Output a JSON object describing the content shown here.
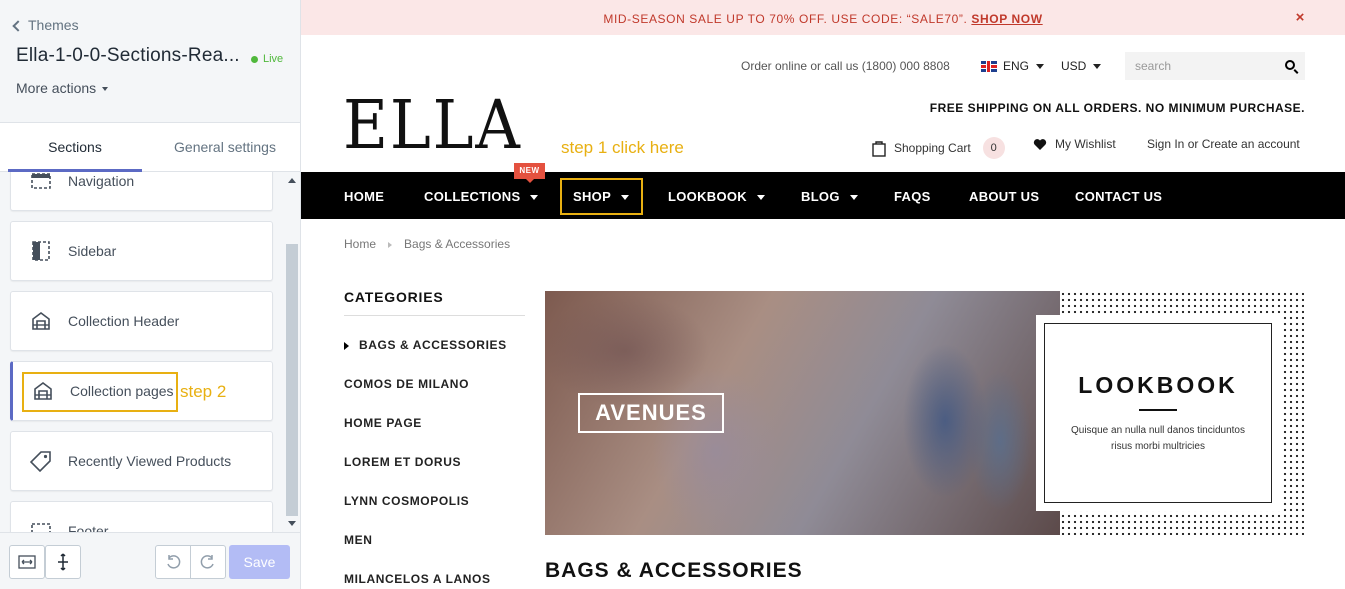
{
  "editor": {
    "back_label": "Themes",
    "theme_name": "Ella-1-0-0-Sections-Rea...",
    "status": "Live",
    "more_actions": "More actions",
    "tabs": [
      {
        "label": "Sections",
        "active": true
      },
      {
        "label": "General settings",
        "active": false
      }
    ],
    "sections": [
      {
        "label": "Navigation",
        "icon": "navigation-icon"
      },
      {
        "label": "Sidebar",
        "icon": "sidebar-icon"
      },
      {
        "label": "Collection Header",
        "icon": "collection-icon"
      },
      {
        "label": "Collection pages",
        "icon": "collection-icon"
      },
      {
        "label": "Recently Viewed Products",
        "icon": "tag-icon"
      },
      {
        "label": "Footer",
        "icon": "footer-icon"
      }
    ],
    "step2_note": "step 2",
    "save_label": "Save",
    "accent": "#5c6ac4",
    "highlight": "#e8b012"
  },
  "store": {
    "promo": {
      "text": "MID-SEASON SALE UP TO 70% OFF. USE CODE: “SALE70”.",
      "link": "SHOP NOW",
      "close": "×"
    },
    "contact": "Order online or call us (1800) 000 8808",
    "language": "ENG",
    "currency": "USD",
    "search_placeholder": "search",
    "logo": "ELLA",
    "free_shipping": "FREE SHIPPING ON ALL ORDERS. NO MINIMUM PURCHASE.",
    "step1_note": "step 1 click here",
    "cart_label": "Shopping Cart",
    "cart_count": "0",
    "wishlist_label": "My Wishlist",
    "account_label": "Sign In or Create an account",
    "nav": [
      {
        "label": "HOME",
        "dropdown": false
      },
      {
        "label": "COLLECTIONS",
        "dropdown": true,
        "badge": "NEW"
      },
      {
        "label": "SHOP",
        "dropdown": true
      },
      {
        "label": "LOOKBOOK",
        "dropdown": true
      },
      {
        "label": "BLOG",
        "dropdown": true
      },
      {
        "label": "FAQS",
        "dropdown": false
      },
      {
        "label": "ABOUT US",
        "dropdown": false
      },
      {
        "label": "CONTACT US",
        "dropdown": false
      }
    ],
    "breadcrumb": [
      "Home",
      "Bags & Accessories"
    ],
    "categories_title": "CATEGORIES",
    "categories": [
      "BAGS & ACCESSORIES",
      "COMOS DE MILANO",
      "HOME PAGE",
      "LOREM ET DORUS",
      "LYNN COSMOPOLIS",
      "MEN",
      "MILANCELOS A LANOS"
    ],
    "banner_label": "AVENUES",
    "lookbook_title": "LOOKBOOK",
    "lookbook_text": "Quisque an nulla null danos tinciduntos risus morbi multricies",
    "page_heading": "BAGS & ACCESSORIES"
  }
}
